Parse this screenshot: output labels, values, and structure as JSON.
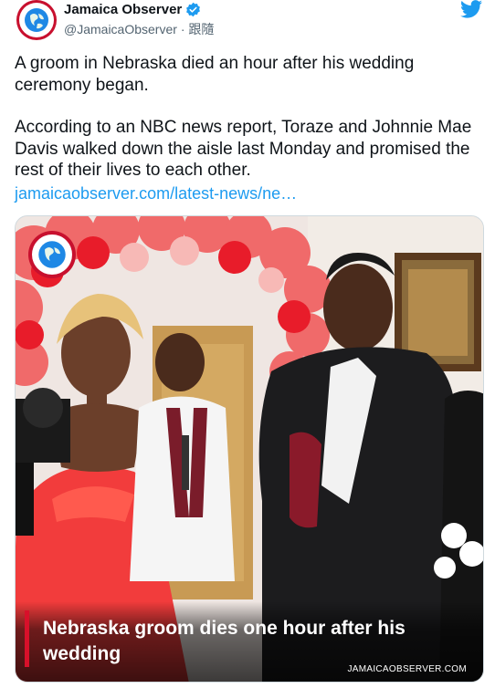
{
  "author": {
    "display_name": "Jamaica Observer",
    "handle": "@JamaicaObserver",
    "separator": "·",
    "follow_label": "跟隨",
    "verified": true
  },
  "icons": {
    "avatar": "globe-logo-icon",
    "verified": "verified-badge-icon",
    "platform": "twitter-bird-icon"
  },
  "colors": {
    "link": "#1d9bf0",
    "verified": "#1d9bf0",
    "brand_red": "#c8102e",
    "accent_bar": "#d8102a"
  },
  "tweet": {
    "text_1": "A groom in Nebraska died an hour after his wedding ceremony began.",
    "text_2": "According to an NBC news report, Toraze and Johnnie Mae Davis walked down the aisle last Monday and promised the rest of their lives to each other.",
    "link_text": "jamaicaobserver.com/latest-news/ne…"
  },
  "card": {
    "headline": "Nebraska groom dies one hour after his wedding",
    "source": "JAMAICAOBSERVER.COM"
  }
}
